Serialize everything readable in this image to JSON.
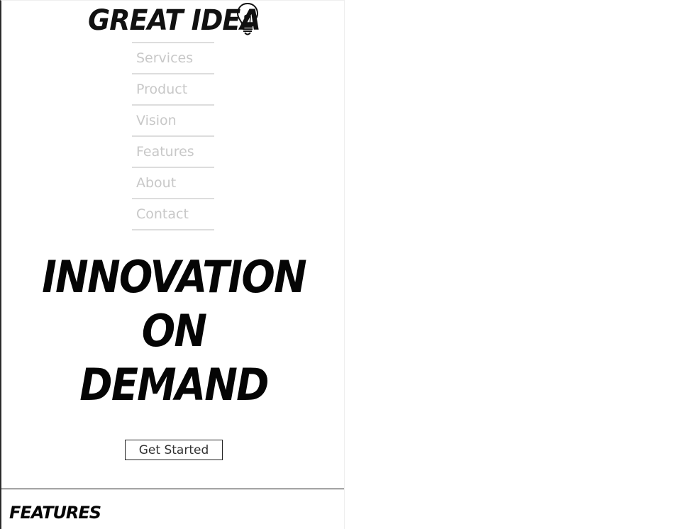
{
  "header": {
    "logo_text": "GREAT IDEA",
    "logo_icon": "lightbulb-icon"
  },
  "nav": {
    "items": [
      {
        "label": "Services"
      },
      {
        "label": "Product"
      },
      {
        "label": "Vision"
      },
      {
        "label": "Features"
      },
      {
        "label": "About"
      },
      {
        "label": "Contact"
      }
    ]
  },
  "hero": {
    "title_lines": [
      "INNOVATION",
      "ON",
      "DEMAND"
    ],
    "cta_label": "Get Started"
  },
  "features": {
    "heading": "FEATURES"
  },
  "colors": {
    "text": "#050505",
    "nav_text": "#c8c8c8",
    "nav_border": "#dddddd",
    "background": "#ffffff"
  }
}
